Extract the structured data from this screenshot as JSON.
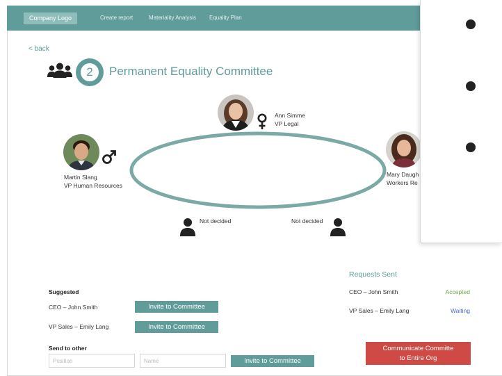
{
  "nav": {
    "logo": "Company Logo",
    "links": [
      "Create report",
      "Materiality Analysis",
      "Equality Plan"
    ]
  },
  "back_label": "< back",
  "step_number": "2",
  "title": "Permanent Equality Committee",
  "members": {
    "top": {
      "name": "Ann Simme",
      "role": "VP Legal",
      "gender": "female-symbol-icon"
    },
    "left": {
      "name": "Martin Slang",
      "role": "VP Human Resources",
      "gender": "male-symbol-icon"
    },
    "right": {
      "name": "Mary Daugh",
      "role": "Workers Re"
    }
  },
  "undecided": [
    "Not decided",
    "Not decided"
  ],
  "suggested": {
    "heading": "Suggested",
    "rows": [
      {
        "label": "CEO – John Smith",
        "button": "Invite to Committee"
      },
      {
        "label": "VP Sales – Emily Lang",
        "button": "Invite to Committee"
      }
    ]
  },
  "send_other": {
    "heading": "Send to other",
    "position_placeholder": "Position",
    "name_placeholder": "Name",
    "button": "Invite to Committee"
  },
  "requests": {
    "title": "Requests Sent",
    "rows": [
      {
        "label": "CEO – John Smith",
        "status": "Accepted",
        "color": "#6aaa3a"
      },
      {
        "label": "VP Sales – Emily Lang",
        "status": "Waiting",
        "color": "#4a68c9"
      }
    ]
  },
  "communicate_button": [
    "Communicate Committe",
    "to Entire Org"
  ],
  "colors": {
    "accent": "#5f9c9a",
    "danger": "#cf4a45"
  }
}
